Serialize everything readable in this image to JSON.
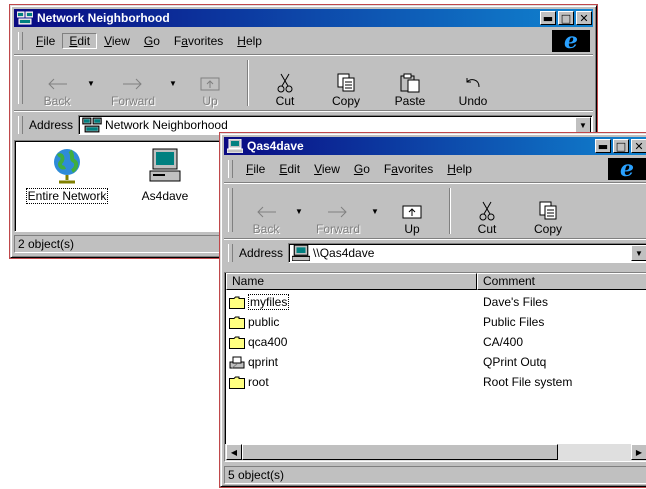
{
  "back_window": {
    "title": "Network Neighborhood",
    "menu": [
      {
        "pre": "",
        "u": "F",
        "post": "ile"
      },
      {
        "pre": "",
        "u": "E",
        "post": "dit"
      },
      {
        "pre": "",
        "u": "V",
        "post": "iew"
      },
      {
        "pre": "",
        "u": "G",
        "post": "o"
      },
      {
        "pre": "F",
        "u": "a",
        "post": "vorites"
      },
      {
        "pre": "",
        "u": "H",
        "post": "elp"
      }
    ],
    "toolbar": {
      "back": "Back",
      "forward": "Forward",
      "up": "Up",
      "cut": "Cut",
      "copy": "Copy",
      "paste": "Paste",
      "undo": "Undo"
    },
    "address_label": "Address",
    "address_value": "Network Neighborhood",
    "items": [
      {
        "label": "Entire Network",
        "icon": "globe-icon"
      },
      {
        "label": "As4dave",
        "icon": "computer-icon"
      }
    ],
    "status": "2 object(s)"
  },
  "front_window": {
    "title": "Qas4dave",
    "menu": [
      {
        "pre": "",
        "u": "F",
        "post": "ile"
      },
      {
        "pre": "",
        "u": "E",
        "post": "dit"
      },
      {
        "pre": "",
        "u": "V",
        "post": "iew"
      },
      {
        "pre": "",
        "u": "G",
        "post": "o"
      },
      {
        "pre": "F",
        "u": "a",
        "post": "vorites"
      },
      {
        "pre": "",
        "u": "H",
        "post": "elp"
      }
    ],
    "toolbar": {
      "back": "Back",
      "forward": "Forward",
      "up": "Up",
      "cut": "Cut",
      "copy": "Copy"
    },
    "address_label": "Address",
    "address_value": "\\\\Qas4dave",
    "columns": {
      "name": "Name",
      "comment": "Comment"
    },
    "rows": [
      {
        "name": "myfiles",
        "comment": "Dave's Files",
        "icon": "folder-icon"
      },
      {
        "name": "public",
        "comment": "Public Files",
        "icon": "folder-icon"
      },
      {
        "name": "qca400",
        "comment": "CA/400",
        "icon": "folder-icon"
      },
      {
        "name": "qprint",
        "comment": "QPrint Outq",
        "icon": "printer-icon"
      },
      {
        "name": "root",
        "comment": "Root File system",
        "icon": "folder-icon"
      }
    ],
    "status": "5 object(s)"
  },
  "colors": {
    "titlebar_start": "#0a0a82",
    "titlebar_end": "#1084d0",
    "face": "#c0c0c0",
    "folder": "#ffff80",
    "border_accent": "#c0474a"
  }
}
